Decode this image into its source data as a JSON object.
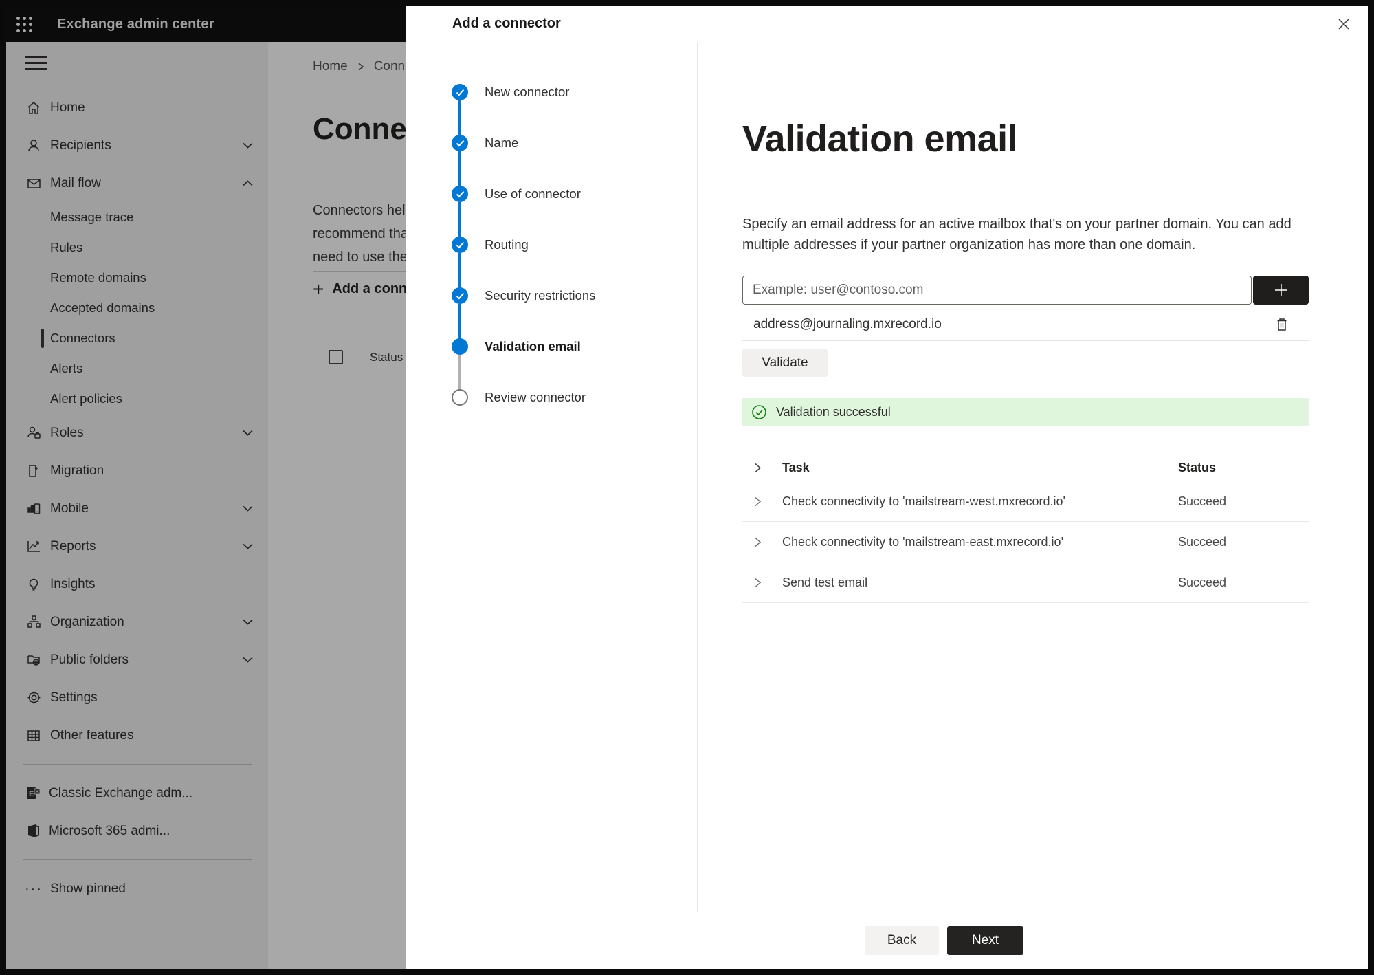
{
  "topbar": {
    "title": "Exchange admin center"
  },
  "sidebar": {
    "items": [
      {
        "label": "Home",
        "icon": "home-icon",
        "type": "main",
        "chevron": "none",
        "selected": false
      },
      {
        "label": "Recipients",
        "icon": "person-icon",
        "type": "main",
        "chevron": "down",
        "selected": false
      },
      {
        "label": "Mail flow",
        "icon": "mail-icon",
        "type": "main",
        "chevron": "up",
        "selected": false
      },
      {
        "label": "Message trace",
        "type": "sub",
        "selected": false
      },
      {
        "label": "Rules",
        "type": "sub",
        "selected": false
      },
      {
        "label": "Remote domains",
        "type": "sub",
        "selected": false
      },
      {
        "label": "Accepted domains",
        "type": "sub",
        "selected": false
      },
      {
        "label": "Connectors",
        "type": "sub",
        "selected": true
      },
      {
        "label": "Alerts",
        "type": "sub",
        "selected": false
      },
      {
        "label": "Alert policies",
        "type": "sub",
        "selected": false
      },
      {
        "label": "Roles",
        "icon": "roles-icon",
        "type": "main",
        "chevron": "down",
        "selected": false
      },
      {
        "label": "Migration",
        "icon": "migration-icon",
        "type": "main",
        "chevron": "none",
        "selected": false
      },
      {
        "label": "Mobile",
        "icon": "mobile-icon",
        "type": "main",
        "chevron": "down",
        "selected": false
      },
      {
        "label": "Reports",
        "icon": "reports-icon",
        "type": "main",
        "chevron": "down",
        "selected": false
      },
      {
        "label": "Insights",
        "icon": "lightbulb-icon",
        "type": "main",
        "chevron": "none",
        "selected": false
      },
      {
        "label": "Organization",
        "icon": "org-chart-icon",
        "type": "main",
        "chevron": "down",
        "selected": false
      },
      {
        "label": "Public folders",
        "icon": "folder-globe-icon",
        "type": "main",
        "chevron": "down",
        "selected": false
      },
      {
        "label": "Settings",
        "icon": "gear-icon",
        "type": "main",
        "chevron": "none",
        "selected": false
      },
      {
        "label": "Other features",
        "icon": "grid-table-icon",
        "type": "main",
        "chevron": "none",
        "selected": false
      }
    ],
    "footer_items": [
      {
        "label": "Classic Exchange adm...",
        "icon": "exchange-logo-icon"
      },
      {
        "label": "Microsoft 365 admi...",
        "icon": "microsoft365-logo-icon"
      }
    ],
    "show_pinned": "Show pinned"
  },
  "background_page": {
    "breadcrumb": [
      "Home",
      "Conne"
    ],
    "heading": "Connec",
    "paragraph_lines": [
      "Connectors help",
      "recommend that",
      "need to use ther"
    ],
    "add_button_label": "Add a conn",
    "status_header": "Status"
  },
  "wizard": {
    "title": "Add a connector",
    "steps": [
      {
        "label": "New connector",
        "state": "completed"
      },
      {
        "label": "Name",
        "state": "completed"
      },
      {
        "label": "Use of connector",
        "state": "completed"
      },
      {
        "label": "Routing",
        "state": "completed"
      },
      {
        "label": "Security restrictions",
        "state": "completed"
      },
      {
        "label": "Validation email",
        "state": "current"
      },
      {
        "label": "Review connector",
        "state": "upcoming"
      }
    ]
  },
  "content": {
    "heading": "Validation email",
    "description": "Specify an email address for an active mailbox that's on your partner domain. You can add multiple addresses if your partner organization has more than one domain.",
    "input_placeholder": "Example: user@contoso.com",
    "added_address": "address@journaling.mxrecord.io",
    "validate_label": "Validate",
    "banner_text": "Validation successful",
    "table": {
      "headers": [
        "Task",
        "Status"
      ],
      "rows": [
        {
          "task": "Check connectivity to 'mailstream-west.mxrecord.io'",
          "status": "Succeed"
        },
        {
          "task": "Check connectivity to 'mailstream-east.mxrecord.io'",
          "status": "Succeed"
        },
        {
          "task": "Send test email",
          "status": "Succeed"
        }
      ]
    },
    "footer": {
      "back": "Back",
      "next": "Next"
    }
  },
  "colors": {
    "accent_blue": "#0078d4",
    "success_green": "#107c10",
    "success_bg": "#dff6dd",
    "dark_button": "#242322",
    "topbar_bg": "#121212"
  }
}
